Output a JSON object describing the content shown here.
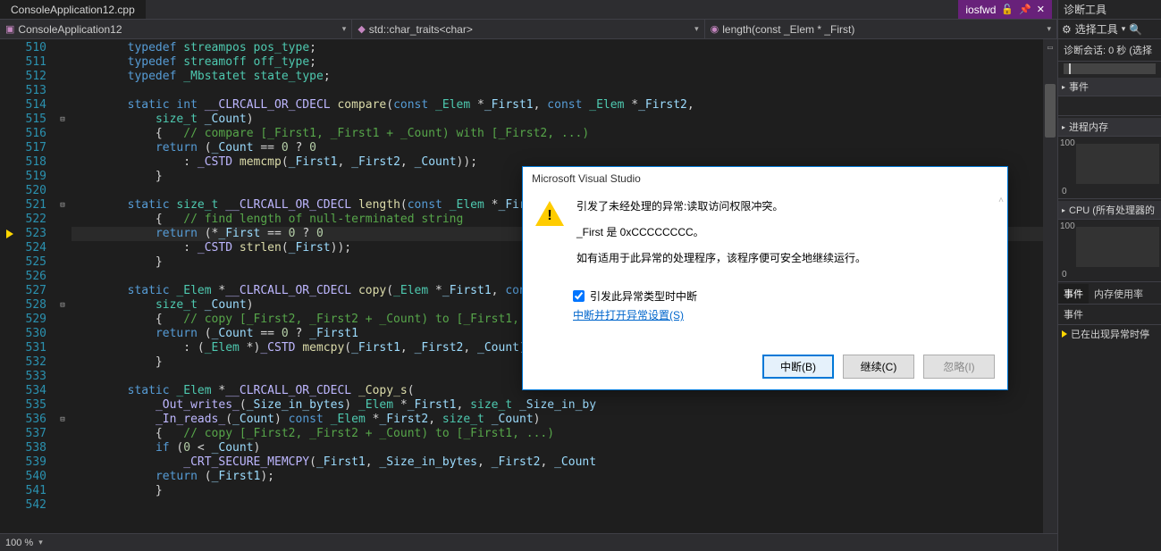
{
  "tabbar": {
    "active_tab": "ConsoleApplication12.cpp",
    "pinned_tab": "iosfwd"
  },
  "breadcrumb": {
    "project": "ConsoleApplication12",
    "scope": "std::char_traits<char>",
    "symbol": "length(const _Elem * _First)"
  },
  "gutter": {
    "start": 510,
    "count": 33,
    "current_line": 523,
    "fold_lines": [
      515,
      521,
      528,
      536
    ]
  },
  "code": {
    "510": [
      [
        "kw",
        "typedef "
      ],
      [
        "type",
        "streampos"
      ],
      [
        "op",
        " "
      ],
      [
        "type",
        "pos_type"
      ],
      [
        "op",
        ";"
      ]
    ],
    "511": [
      [
        "kw",
        "typedef "
      ],
      [
        "type",
        "streamoff"
      ],
      [
        "op",
        " "
      ],
      [
        "type",
        "off_type"
      ],
      [
        "op",
        ";"
      ]
    ],
    "512": [
      [
        "kw",
        "typedef "
      ],
      [
        "type",
        "_Mbstatet"
      ],
      [
        "op",
        " "
      ],
      [
        "type",
        "state_type"
      ],
      [
        "op",
        ";"
      ]
    ],
    "513": [],
    "514": [
      [
        "kw",
        "static "
      ],
      [
        "kw",
        "int "
      ],
      [
        "mac",
        "__CLRCALL_OR_CDECL"
      ],
      [
        "op",
        " "
      ],
      [
        "fn",
        "compare"
      ],
      [
        "op",
        "("
      ],
      [
        "kw",
        "const "
      ],
      [
        "type",
        "_Elem"
      ],
      [
        "op",
        " *"
      ],
      [
        "param",
        "_First1"
      ],
      [
        "op",
        ", "
      ],
      [
        "kw",
        "const "
      ],
      [
        "type",
        "_Elem"
      ],
      [
        "op",
        " *"
      ],
      [
        "param",
        "_First2"
      ],
      [
        "op",
        ","
      ]
    ],
    "515": [
      [
        "op",
        "    "
      ],
      [
        "type",
        "size_t"
      ],
      [
        "op",
        " "
      ],
      [
        "param",
        "_Count"
      ],
      [
        "op",
        ")"
      ]
    ],
    "516": [
      [
        "op",
        "    {   "
      ],
      [
        "cm",
        "// compare [_First1, _First1 + _Count) with [_First2, ...)"
      ]
    ],
    "517": [
      [
        "op",
        "    "
      ],
      [
        "kw",
        "return"
      ],
      [
        "op",
        " ("
      ],
      [
        "param",
        "_Count"
      ],
      [
        "op",
        " == "
      ],
      [
        "num",
        "0"
      ],
      [
        "op",
        " ? "
      ],
      [
        "num",
        "0"
      ]
    ],
    "518": [
      [
        "op",
        "        : "
      ],
      [
        "mac",
        "_CSTD"
      ],
      [
        "op",
        " "
      ],
      [
        "fn",
        "memcmp"
      ],
      [
        "op",
        "("
      ],
      [
        "param",
        "_First1"
      ],
      [
        "op",
        ", "
      ],
      [
        "param",
        "_First2"
      ],
      [
        "op",
        ", "
      ],
      [
        "param",
        "_Count"
      ],
      [
        "op",
        "));"
      ]
    ],
    "519": [
      [
        "op",
        "    }"
      ]
    ],
    "520": [],
    "521": [
      [
        "kw",
        "static "
      ],
      [
        "type",
        "size_t"
      ],
      [
        "op",
        " "
      ],
      [
        "mac",
        "__CLRCALL_OR_CDECL"
      ],
      [
        "op",
        " "
      ],
      [
        "fn",
        "length"
      ],
      [
        "op",
        "("
      ],
      [
        "kw",
        "const "
      ],
      [
        "type",
        "_Elem"
      ],
      [
        "op",
        " *"
      ],
      [
        "param",
        "_First"
      ],
      [
        "op",
        ")"
      ]
    ],
    "522": [
      [
        "op",
        "    {   "
      ],
      [
        "cm",
        "// find length of null-terminated string"
      ]
    ],
    "523": [
      [
        "op",
        "    "
      ],
      [
        "kw",
        "return"
      ],
      [
        "op",
        " (*"
      ],
      [
        "param",
        "_First"
      ],
      [
        "op",
        " == "
      ],
      [
        "num",
        "0"
      ],
      [
        "op",
        " ? "
      ],
      [
        "num",
        "0"
      ]
    ],
    "524": [
      [
        "op",
        "        : "
      ],
      [
        "mac",
        "_CSTD"
      ],
      [
        "op",
        " "
      ],
      [
        "fn",
        "strlen"
      ],
      [
        "op",
        "("
      ],
      [
        "param",
        "_First"
      ],
      [
        "op",
        "));"
      ]
    ],
    "525": [
      [
        "op",
        "    }"
      ]
    ],
    "526": [],
    "527": [
      [
        "kw",
        "static "
      ],
      [
        "type",
        "_Elem"
      ],
      [
        "op",
        " *"
      ],
      [
        "mac",
        "__CLRCALL_OR_CDECL"
      ],
      [
        "op",
        " "
      ],
      [
        "fn",
        "copy"
      ],
      [
        "op",
        "("
      ],
      [
        "type",
        "_Elem"
      ],
      [
        "op",
        " *"
      ],
      [
        "param",
        "_First1"
      ],
      [
        "op",
        ", "
      ],
      [
        "kw",
        "const "
      ],
      [
        "type",
        "_Elem"
      ],
      [
        "op",
        " *"
      ]
    ],
    "528": [
      [
        "op",
        "    "
      ],
      [
        "type",
        "size_t"
      ],
      [
        "op",
        " "
      ],
      [
        "param",
        "_Count"
      ],
      [
        "op",
        ")"
      ]
    ],
    "529": [
      [
        "op",
        "    {   "
      ],
      [
        "cm",
        "// copy [_First2, _First2 + _Count) to [_First1, ...)"
      ]
    ],
    "530": [
      [
        "op",
        "    "
      ],
      [
        "kw",
        "return"
      ],
      [
        "op",
        " ("
      ],
      [
        "param",
        "_Count"
      ],
      [
        "op",
        " == "
      ],
      [
        "num",
        "0"
      ],
      [
        "op",
        " ? "
      ],
      [
        "param",
        "_First1"
      ]
    ],
    "531": [
      [
        "op",
        "        : ("
      ],
      [
        "type",
        "_Elem"
      ],
      [
        "op",
        " *)"
      ],
      [
        "mac",
        "_CSTD"
      ],
      [
        "op",
        " "
      ],
      [
        "fn",
        "memcpy"
      ],
      [
        "op",
        "("
      ],
      [
        "param",
        "_First1"
      ],
      [
        "op",
        ", "
      ],
      [
        "param",
        "_First2"
      ],
      [
        "op",
        ", "
      ],
      [
        "param",
        "_Count"
      ],
      [
        "op",
        "));"
      ]
    ],
    "532": [
      [
        "op",
        "    }"
      ]
    ],
    "533": [],
    "534": [
      [
        "kw",
        "static "
      ],
      [
        "type",
        "_Elem"
      ],
      [
        "op",
        " *"
      ],
      [
        "mac",
        "__CLRCALL_OR_CDECL"
      ],
      [
        "op",
        " "
      ],
      [
        "fn",
        "_Copy_s"
      ],
      [
        "op",
        "("
      ]
    ],
    "535": [
      [
        "op",
        "    "
      ],
      [
        "mac",
        "_Out_writes_"
      ],
      [
        "op",
        "("
      ],
      [
        "param",
        "_Size_in_bytes"
      ],
      [
        "op",
        ") "
      ],
      [
        "type",
        "_Elem"
      ],
      [
        "op",
        " *"
      ],
      [
        "param",
        "_First1"
      ],
      [
        "op",
        ", "
      ],
      [
        "type",
        "size_t"
      ],
      [
        "op",
        " "
      ],
      [
        "param",
        "_Size_in_by"
      ]
    ],
    "536": [
      [
        "op",
        "    "
      ],
      [
        "mac",
        "_In_reads_"
      ],
      [
        "op",
        "("
      ],
      [
        "param",
        "_Count"
      ],
      [
        "op",
        ") "
      ],
      [
        "kw",
        "const "
      ],
      [
        "type",
        "_Elem"
      ],
      [
        "op",
        " *"
      ],
      [
        "param",
        "_First2"
      ],
      [
        "op",
        ", "
      ],
      [
        "type",
        "size_t"
      ],
      [
        "op",
        " "
      ],
      [
        "param",
        "_Count"
      ],
      [
        "op",
        ")"
      ]
    ],
    "537": [
      [
        "op",
        "    {   "
      ],
      [
        "cm",
        "// copy [_First2, _First2 + _Count) to [_First1, ...)"
      ]
    ],
    "538": [
      [
        "op",
        "    "
      ],
      [
        "kw",
        "if"
      ],
      [
        "op",
        " ("
      ],
      [
        "num",
        "0"
      ],
      [
        "op",
        " < "
      ],
      [
        "param",
        "_Count"
      ],
      [
        "op",
        ")"
      ]
    ],
    "539": [
      [
        "op",
        "        "
      ],
      [
        "mac",
        "_CRT_SECURE_MEMCPY"
      ],
      [
        "op",
        "("
      ],
      [
        "param",
        "_First1"
      ],
      [
        "op",
        ", "
      ],
      [
        "param",
        "_Size_in_bytes"
      ],
      [
        "op",
        ", "
      ],
      [
        "param",
        "_First2"
      ],
      [
        "op",
        ", "
      ],
      [
        "param",
        "_Count"
      ]
    ],
    "540": [
      [
        "op",
        "    "
      ],
      [
        "kw",
        "return"
      ],
      [
        "op",
        " ("
      ],
      [
        "param",
        "_First1"
      ],
      [
        "op",
        ");"
      ]
    ],
    "541": [
      [
        "op",
        "    }"
      ]
    ],
    "542": []
  },
  "status": {
    "zoom": "100 %"
  },
  "diag": {
    "title": "诊断工具",
    "tool_select": "选择工具",
    "session": "诊断会话: 0 秒 (选择",
    "sections": {
      "events": "事件",
      "memory": "进程内存",
      "cpu": "CPU (所有处理器的"
    },
    "mem_top": "100",
    "mem_bot": "0",
    "cpu_top": "100",
    "cpu_bot": "0",
    "tabs": {
      "events": "事件",
      "mem_usage": "内存使用率"
    },
    "col_event": "事件",
    "row1": "已在出现异常时停"
  },
  "dialog": {
    "title": "Microsoft Visual Studio",
    "line1": "引发了未经处理的异常:读取访问权限冲突。",
    "line2": "_First 是 0xCCCCCCCC。",
    "line3": "如有适用于此异常的处理程序，该程序便可安全地继续运行。",
    "checkbox": "引发此异常类型时中断",
    "link": "中断并打开异常设置(S)",
    "btn_break": "中断(B)",
    "btn_continue": "继续(C)",
    "btn_ignore": "忽略(I)"
  }
}
